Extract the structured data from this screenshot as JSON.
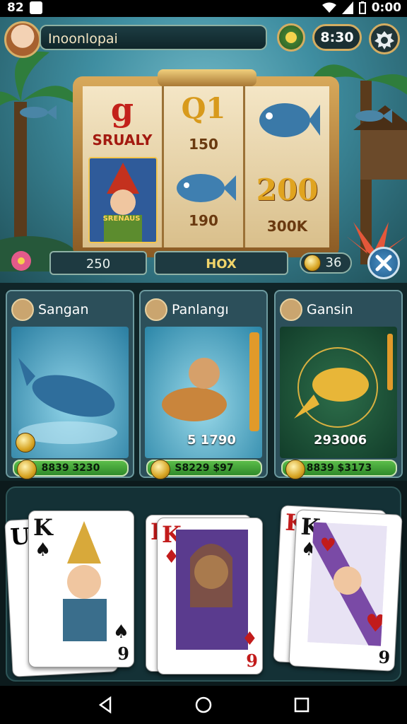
{
  "status": {
    "left_text": "82",
    "time": "0:00"
  },
  "header": {
    "player_name": "Inoonlopai",
    "timer": "8:30"
  },
  "reels": {
    "reel1": {
      "top_num": "g",
      "label": "SRUALY",
      "badge": "SRENAUS"
    },
    "reel2": {
      "top_num": "Q1",
      "mid_num": "150",
      "low_num": "190"
    },
    "reel3": {
      "big_num": "200",
      "label": "300K"
    }
  },
  "controls": {
    "left_value": "250",
    "center_label": "HOX",
    "coins": "36"
  },
  "cards": [
    {
      "name": "Sangan",
      "amount": "",
      "bar": "8839 3230"
    },
    {
      "name": "Panlangı",
      "amount": "5 1790",
      "bar": "S8229 $97"
    },
    {
      "name": "Gansin",
      "amount": "293006",
      "bar": "8839 $3173"
    }
  ],
  "hand": [
    {
      "rank_back": "U",
      "rank_front": "K",
      "bottom": "9"
    },
    {
      "rank_back": "I",
      "rank_front": "K",
      "bottom": "9"
    },
    {
      "rank_back": "K",
      "rank_front": "K",
      "bottom": "9"
    }
  ],
  "colors": {
    "gold": "#d4ad62",
    "green": "#4bb63f",
    "teal": "#2c4f5a"
  },
  "icons": [
    "signal-icon",
    "wifi-icon",
    "battery-icon",
    "settings-icon",
    "close-icon",
    "back-icon",
    "home-icon",
    "recents-icon"
  ]
}
